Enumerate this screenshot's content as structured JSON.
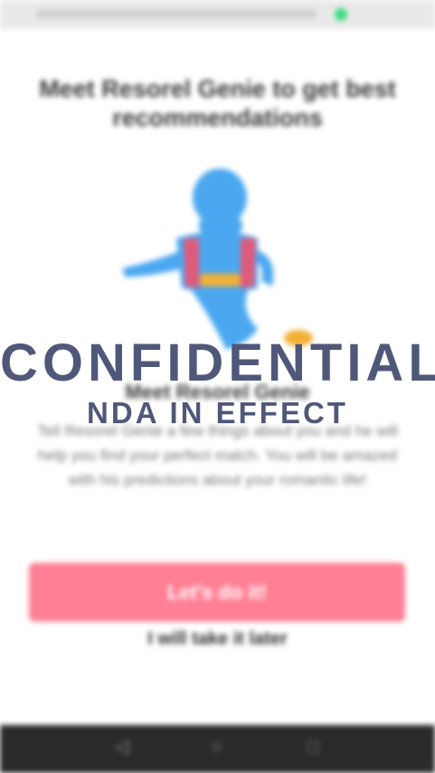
{
  "status_bar": {
    "indicator_color": "#3ddc84"
  },
  "onboarding": {
    "title": "Meet Resorel Genie to get best recommendations",
    "illustration_icon": "genie-illustration",
    "heading": "Meet Resorel Genie",
    "description": "Tell Resorel Genie a few things about you and he will help you find your perfect match. You will be amazed with his predictions about your romantic life!",
    "primary_button": "Let's do it!",
    "secondary_link": "I will take it later"
  },
  "watermark": {
    "line1": "CONFIDENTIAL",
    "line2": "NDA IN EFFECT"
  },
  "nav_bar": {
    "back": "◁",
    "home": "○",
    "recents": "□"
  },
  "colors": {
    "accent": "#ff7f95",
    "watermark": "#50587a",
    "nav_bg": "#2a2a2a"
  }
}
